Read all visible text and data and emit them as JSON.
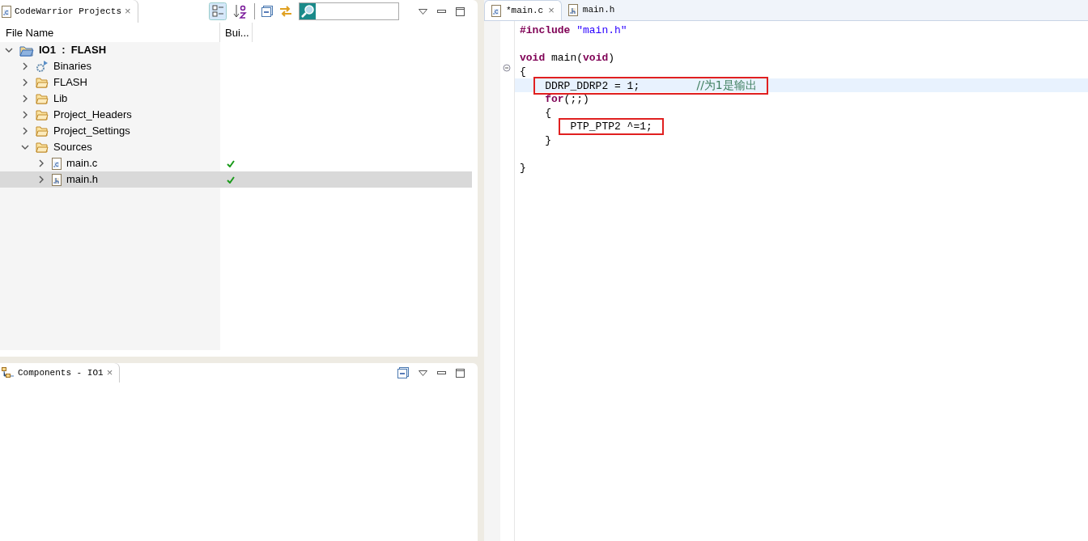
{
  "projects_view": {
    "tab": {
      "title": "CodeWarrior Projects",
      "close": "×"
    },
    "columns": [
      "File Name",
      "Bui..."
    ],
    "tree": [
      {
        "label": "IO1  :  FLASH",
        "kind": "project",
        "expanded": true,
        "selected": false,
        "built": false,
        "children": [
          {
            "label": "Binaries",
            "kind": "binaries",
            "expanded": false,
            "selected": false,
            "built": false
          },
          {
            "label": "FLASH",
            "kind": "folder",
            "expanded": false,
            "selected": false,
            "built": false
          },
          {
            "label": "Lib",
            "kind": "folder",
            "expanded": false,
            "selected": false,
            "built": false
          },
          {
            "label": "Project_Headers",
            "kind": "folder",
            "expanded": false,
            "selected": false,
            "built": false
          },
          {
            "label": "Project_Settings",
            "kind": "folder",
            "expanded": false,
            "selected": false,
            "built": false
          },
          {
            "label": "Sources",
            "kind": "folder",
            "expanded": true,
            "selected": false,
            "built": false,
            "children": [
              {
                "label": "main.c",
                "kind": "c-file",
                "expanded": false,
                "selected": false,
                "built": true
              },
              {
                "label": "main.h",
                "kind": "h-file",
                "expanded": false,
                "selected": true,
                "built": true
              }
            ]
          }
        ]
      }
    ]
  },
  "components_view": {
    "tab": {
      "title": "Components - IO1",
      "close": "×"
    }
  },
  "editor": {
    "tabs": [
      {
        "title": "*main.c",
        "kind": "c-file",
        "selected": true,
        "close": "×"
      },
      {
        "title": "main.h",
        "kind": "h-file",
        "selected": false
      }
    ],
    "lines": [
      {
        "kind": "code",
        "current": false,
        "boxed": false,
        "tokens": [
          {
            "kind": "preproc",
            "text": "#include "
          },
          {
            "kind": "string",
            "text": "\"main.h\""
          }
        ]
      },
      {
        "kind": "blank"
      },
      {
        "kind": "code",
        "current": false,
        "boxed": false,
        "tokens": [
          {
            "kind": "keyword",
            "text": "void"
          },
          {
            "kind": "plain",
            "text": " main("
          },
          {
            "kind": "keyword",
            "text": "void"
          },
          {
            "kind": "plain",
            "text": ")"
          }
        ]
      },
      {
        "kind": "code",
        "current": false,
        "boxed": false,
        "tokens": [
          {
            "kind": "plain",
            "text": "{"
          }
        ]
      },
      {
        "kind": "block",
        "children": [
          {
            "kind": "code",
            "current": true,
            "boxed": true,
            "tokens": [
              {
                "kind": "plain",
                "text": "DDRP_DDRP2 = 1;         "
              },
              {
                "kind": "comment",
                "text": "//为1是输出"
              }
            ]
          },
          {
            "kind": "code",
            "current": false,
            "boxed": false,
            "tokens": [
              {
                "kind": "keyword",
                "text": "for"
              },
              {
                "kind": "plain",
                "text": "(;;)"
              }
            ]
          },
          {
            "kind": "code",
            "current": false,
            "boxed": false,
            "tokens": [
              {
                "kind": "plain",
                "text": "{"
              }
            ]
          },
          {
            "kind": "block",
            "children": [
              {
                "kind": "code",
                "current": false,
                "boxed": true,
                "tokens": [
                  {
                    "kind": "plain",
                    "text": "PTP_PTP2 ^=1;"
                  }
                ]
              }
            ]
          },
          {
            "kind": "code",
            "current": false,
            "boxed": false,
            "tokens": [
              {
                "kind": "plain",
                "text": "}"
              }
            ]
          }
        ]
      },
      {
        "kind": "blank"
      },
      {
        "kind": "code",
        "current": false,
        "boxed": false,
        "tokens": [
          {
            "kind": "plain",
            "text": "}"
          }
        ]
      }
    ]
  }
}
